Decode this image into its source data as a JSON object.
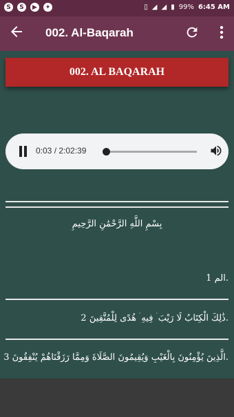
{
  "status_bar": {
    "battery": "99%",
    "time": "6:45 AM"
  },
  "app_bar": {
    "back_icon": "arrow-left-icon",
    "title": "002. Al-Baqarah",
    "refresh_icon": "refresh-icon",
    "menu_icon": "more-vert-icon"
  },
  "banner": {
    "label": "002. AL BAQARAH",
    "color": "#b22727"
  },
  "player": {
    "time_display": "0:03 / 2:02:39",
    "progress_fraction": 0.0,
    "state_icon": "pause-icon",
    "volume_icon": "volume-icon"
  },
  "content": {
    "bismillah": "بِسْمِ اللَّهِ الرَّحْمَٰنِ الرَّحِيمِ",
    "verses": [
      {
        "text": "الم 1."
      },
      {
        "text": "ذَٰلِكَ الْكِتَابُ لَا رَيْبَ ۛ فِيهِ ۛ هُدًى لِلْمُتَّقِينَ 2."
      },
      {
        "text": "الَّذِينَ يُؤْمِنُونَ بِالْغَيْبِ وَيُقِيمُونَ الصَّلَاةَ وَمِمَّا رَزَقْنَاهُمْ يُنْفِقُونَ 3."
      }
    ]
  },
  "colors": {
    "background": "#2f4f4a",
    "app_bar": "#6e3550",
    "status_bar": "#5e2a43"
  }
}
